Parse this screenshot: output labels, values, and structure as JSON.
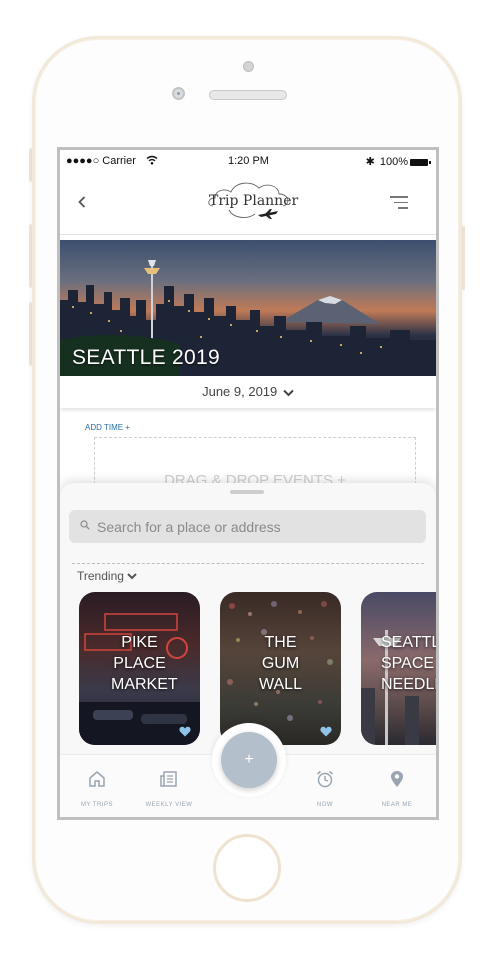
{
  "status_bar": {
    "carrier": "●●●●○ Carrier",
    "time": "1:20 PM",
    "battery": "100%"
  },
  "header": {
    "back_icon": "chevron-left-icon",
    "logo_text": "Trip Planner",
    "menu_icon": "hamburger-menu-icon"
  },
  "hero": {
    "title": "SEATTLE 2019"
  },
  "date": {
    "label": "June 9, 2019",
    "icon": "chevron-down-icon"
  },
  "schedule": {
    "add_time": "ADD TIME +",
    "dropzone": "DRAG & DROP EVENTS +"
  },
  "sheet": {
    "search_placeholder": "Search for a place or address",
    "trending_label": "Trending",
    "cards": [
      {
        "label": "PIKE PLACE MARKET",
        "favorited": true
      },
      {
        "label": "THE GUM WALL",
        "favorited": true
      },
      {
        "label": "SEATTLE SPACE NEEDLE",
        "favorited": false
      }
    ]
  },
  "tabbar": {
    "tabs": [
      {
        "label": "MY TRIPS",
        "icon": "home-icon"
      },
      {
        "label": "WEEKLY VIEW",
        "icon": "newspaper-icon"
      },
      {
        "label": "NOW",
        "icon": "alarm-clock-icon"
      },
      {
        "label": "NEAR ME",
        "icon": "map-pin-icon"
      }
    ],
    "fab_label": "+"
  },
  "colors": {
    "accent_blue": "#2a6fa8",
    "fab": "#b3bfcb",
    "heart": "#8fc3e8",
    "tab_icon": "#9aa5b1"
  }
}
